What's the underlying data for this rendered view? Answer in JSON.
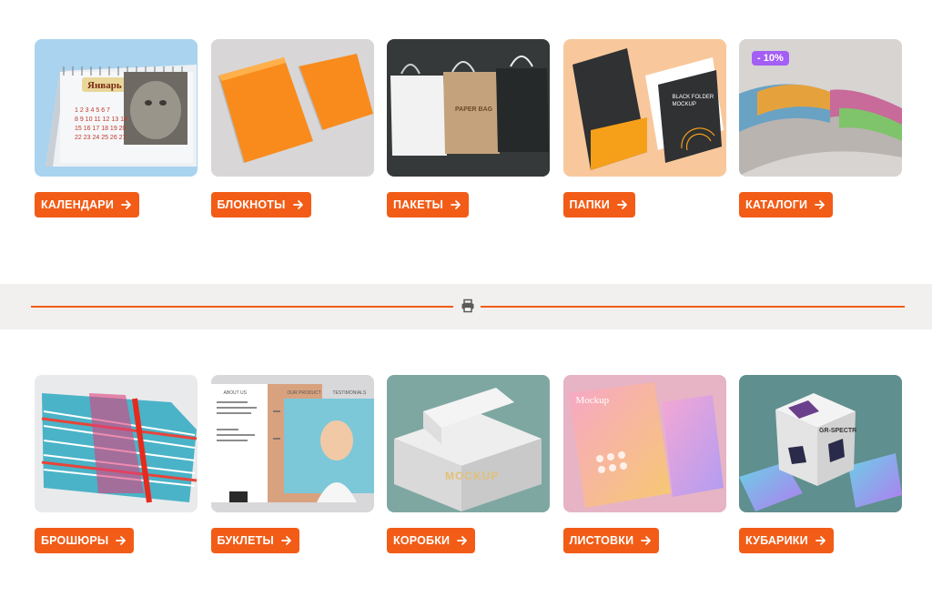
{
  "categories_top": [
    {
      "label": "КАЛЕНДАРИ",
      "icon": "arrow-right-icon"
    },
    {
      "label": "БЛОКНОТЫ",
      "icon": "arrow-right-icon"
    },
    {
      "label": "ПАКЕТЫ",
      "icon": "arrow-right-icon"
    },
    {
      "label": "ПАПКИ",
      "icon": "arrow-right-icon"
    },
    {
      "label": "КАТАЛОГИ",
      "icon": "arrow-right-icon",
      "badge": "- 10%"
    }
  ],
  "categories_bottom": [
    {
      "label": "БРОШЮРЫ",
      "icon": "arrow-right-icon"
    },
    {
      "label": "БУКЛЕТЫ",
      "icon": "arrow-right-icon"
    },
    {
      "label": "КОРОБКИ",
      "icon": "arrow-right-icon"
    },
    {
      "label": "ЛИСТОВКИ",
      "icon": "arrow-right-icon"
    },
    {
      "label": "КУБАРИКИ",
      "icon": "arrow-right-icon"
    }
  ],
  "thumb_text": {
    "calendar_month": "Январь",
    "bag_label": "PAPER BAG",
    "folder_label": "BLACK FOLDER MOCKUP",
    "booklet_about": "ABOUT US",
    "booklet_product": "OUR PRODUCT",
    "booklet_testimonials": "TESTIMONIALS",
    "box_label": "MOCKUP",
    "flyer_label": "Mockup",
    "cube_label": "GR-SPECTR"
  },
  "divider": {
    "icon": "printer-icon"
  },
  "colors": {
    "accent": "#f25c17",
    "badge": "#a35ef5",
    "band": "#f2f0ee"
  }
}
